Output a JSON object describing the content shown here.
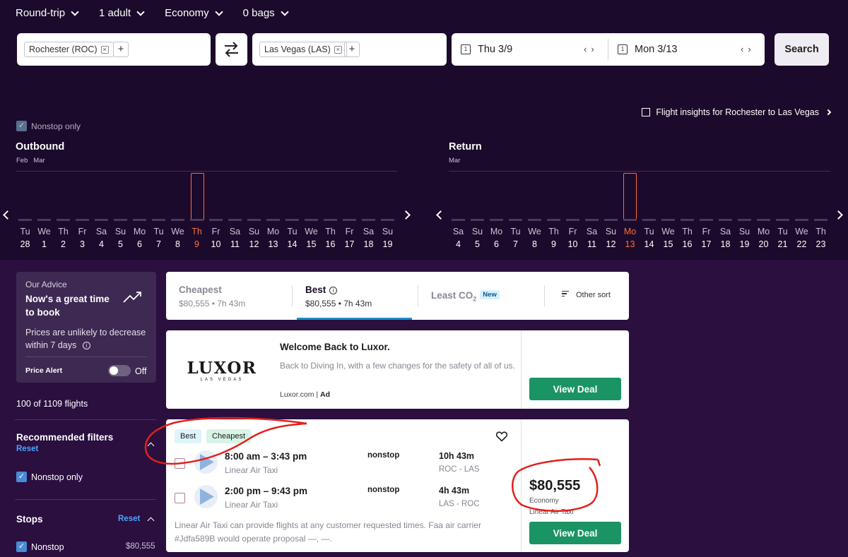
{
  "header": {
    "trip_type": "Round-trip",
    "travelers": "1 adult",
    "cabin": "Economy",
    "bags": "0 bags"
  },
  "search": {
    "origin": "Rochester (ROC)",
    "destination": "Las Vegas (LAS)",
    "depart_date": "Thu 3/9",
    "return_date": "Mon 3/13",
    "calendar_glyph": "1",
    "search_label": "Search"
  },
  "insights": {
    "label": "Flight insights for Rochester to Las Vegas"
  },
  "calendar": {
    "nonstop_label": "Nonstop only",
    "outbound": {
      "title": "Outbound",
      "months": "Feb   Mar",
      "days": [
        {
          "dow": "Tu",
          "num": "28"
        },
        {
          "dow": "We",
          "num": "1"
        },
        {
          "dow": "Th",
          "num": "2"
        },
        {
          "dow": "Fr",
          "num": "3"
        },
        {
          "dow": "Sa",
          "num": "4"
        },
        {
          "dow": "Su",
          "num": "5"
        },
        {
          "dow": "Mo",
          "num": "6"
        },
        {
          "dow": "Tu",
          "num": "7"
        },
        {
          "dow": "We",
          "num": "8"
        },
        {
          "dow": "Th",
          "num": "9"
        },
        {
          "dow": "Fr",
          "num": "10"
        },
        {
          "dow": "Sa",
          "num": "11"
        },
        {
          "dow": "Su",
          "num": "12"
        },
        {
          "dow": "Mo",
          "num": "13"
        },
        {
          "dow": "Tu",
          "num": "14"
        },
        {
          "dow": "We",
          "num": "15"
        },
        {
          "dow": "Th",
          "num": "16"
        },
        {
          "dow": "Fr",
          "num": "17"
        },
        {
          "dow": "Sa",
          "num": "18"
        },
        {
          "dow": "Su",
          "num": "19"
        }
      ],
      "selected_index": 9
    },
    "return": {
      "title": "Return",
      "months": "Mar",
      "days": [
        {
          "dow": "Sa",
          "num": "4"
        },
        {
          "dow": "Su",
          "num": "5"
        },
        {
          "dow": "Mo",
          "num": "6"
        },
        {
          "dow": "Tu",
          "num": "7"
        },
        {
          "dow": "We",
          "num": "8"
        },
        {
          "dow": "Th",
          "num": "9"
        },
        {
          "dow": "Fr",
          "num": "10"
        },
        {
          "dow": "Sa",
          "num": "11"
        },
        {
          "dow": "Su",
          "num": "12"
        },
        {
          "dow": "Mo",
          "num": "13"
        },
        {
          "dow": "Tu",
          "num": "14"
        },
        {
          "dow": "We",
          "num": "15"
        },
        {
          "dow": "Th",
          "num": "16"
        },
        {
          "dow": "Fr",
          "num": "17"
        },
        {
          "dow": "Sa",
          "num": "18"
        },
        {
          "dow": "Su",
          "num": "19"
        },
        {
          "dow": "Mo",
          "num": "20"
        },
        {
          "dow": "Tu",
          "num": "21"
        },
        {
          "dow": "We",
          "num": "22"
        },
        {
          "dow": "Th",
          "num": "23"
        }
      ],
      "selected_index": 9
    }
  },
  "advice": {
    "label": "Our Advice",
    "headline": "Now's a great time to book",
    "description": "Prices are unlikely to decrease within 7 days",
    "price_alert_label": "Price Alert",
    "toggle_state": "Off"
  },
  "filters": {
    "flight_count": "100 of 1109 flights",
    "recommended_title": "Recommended filters",
    "reset_label": "Reset",
    "nonstop_only_label": "Nonstop only",
    "stops_title": "Stops",
    "nonstop_label": "Nonstop",
    "nonstop_price": "$80,555"
  },
  "sort": {
    "cheapest": {
      "title": "Cheapest",
      "sub": "$80,555 • 7h 43m"
    },
    "best": {
      "title": "Best",
      "sub": "$80,555 • 7h 43m"
    },
    "least_co2": {
      "title": "Least CO",
      "sub_script": "2",
      "badge": "New"
    },
    "other": "Other sort"
  },
  "ad": {
    "logo_main": "LUXOR",
    "logo_sub": "LAS VEGAS",
    "title": "Welcome Back to Luxor.",
    "body": "Back to Diving In, with a few changes for the safety of all of us.",
    "source": "Luxor.com",
    "ad_label": "Ad",
    "cta": "View Deal"
  },
  "result": {
    "tags": [
      "Best",
      "Cheapest"
    ],
    "legs": [
      {
        "time": "8:00 am – 3:43 pm",
        "airline": "Linear Air Taxi",
        "stops": "nonstop",
        "duration": "10h 43m",
        "route": "ROC - LAS"
      },
      {
        "time": "2:00 pm – 9:43 pm",
        "airline": "Linear Air Taxi",
        "stops": "nonstop",
        "duration": "4h 43m",
        "route": "LAS - ROC"
      }
    ],
    "note": "Linear Air Taxi can provide flights at any customer requested times. Faa air carrier #Jdfa589B would operate proposal —, —.",
    "price": "$80,555",
    "cabin": "Economy",
    "price_airline": "Linear Air Taxi",
    "cta": "View Deal"
  },
  "colors": {
    "background": "#1b0a2b",
    "selected_day": "#ff6d3a",
    "deal_button": "#1a9463",
    "link": "#4fa3ff",
    "annotation": "#e0201b"
  }
}
